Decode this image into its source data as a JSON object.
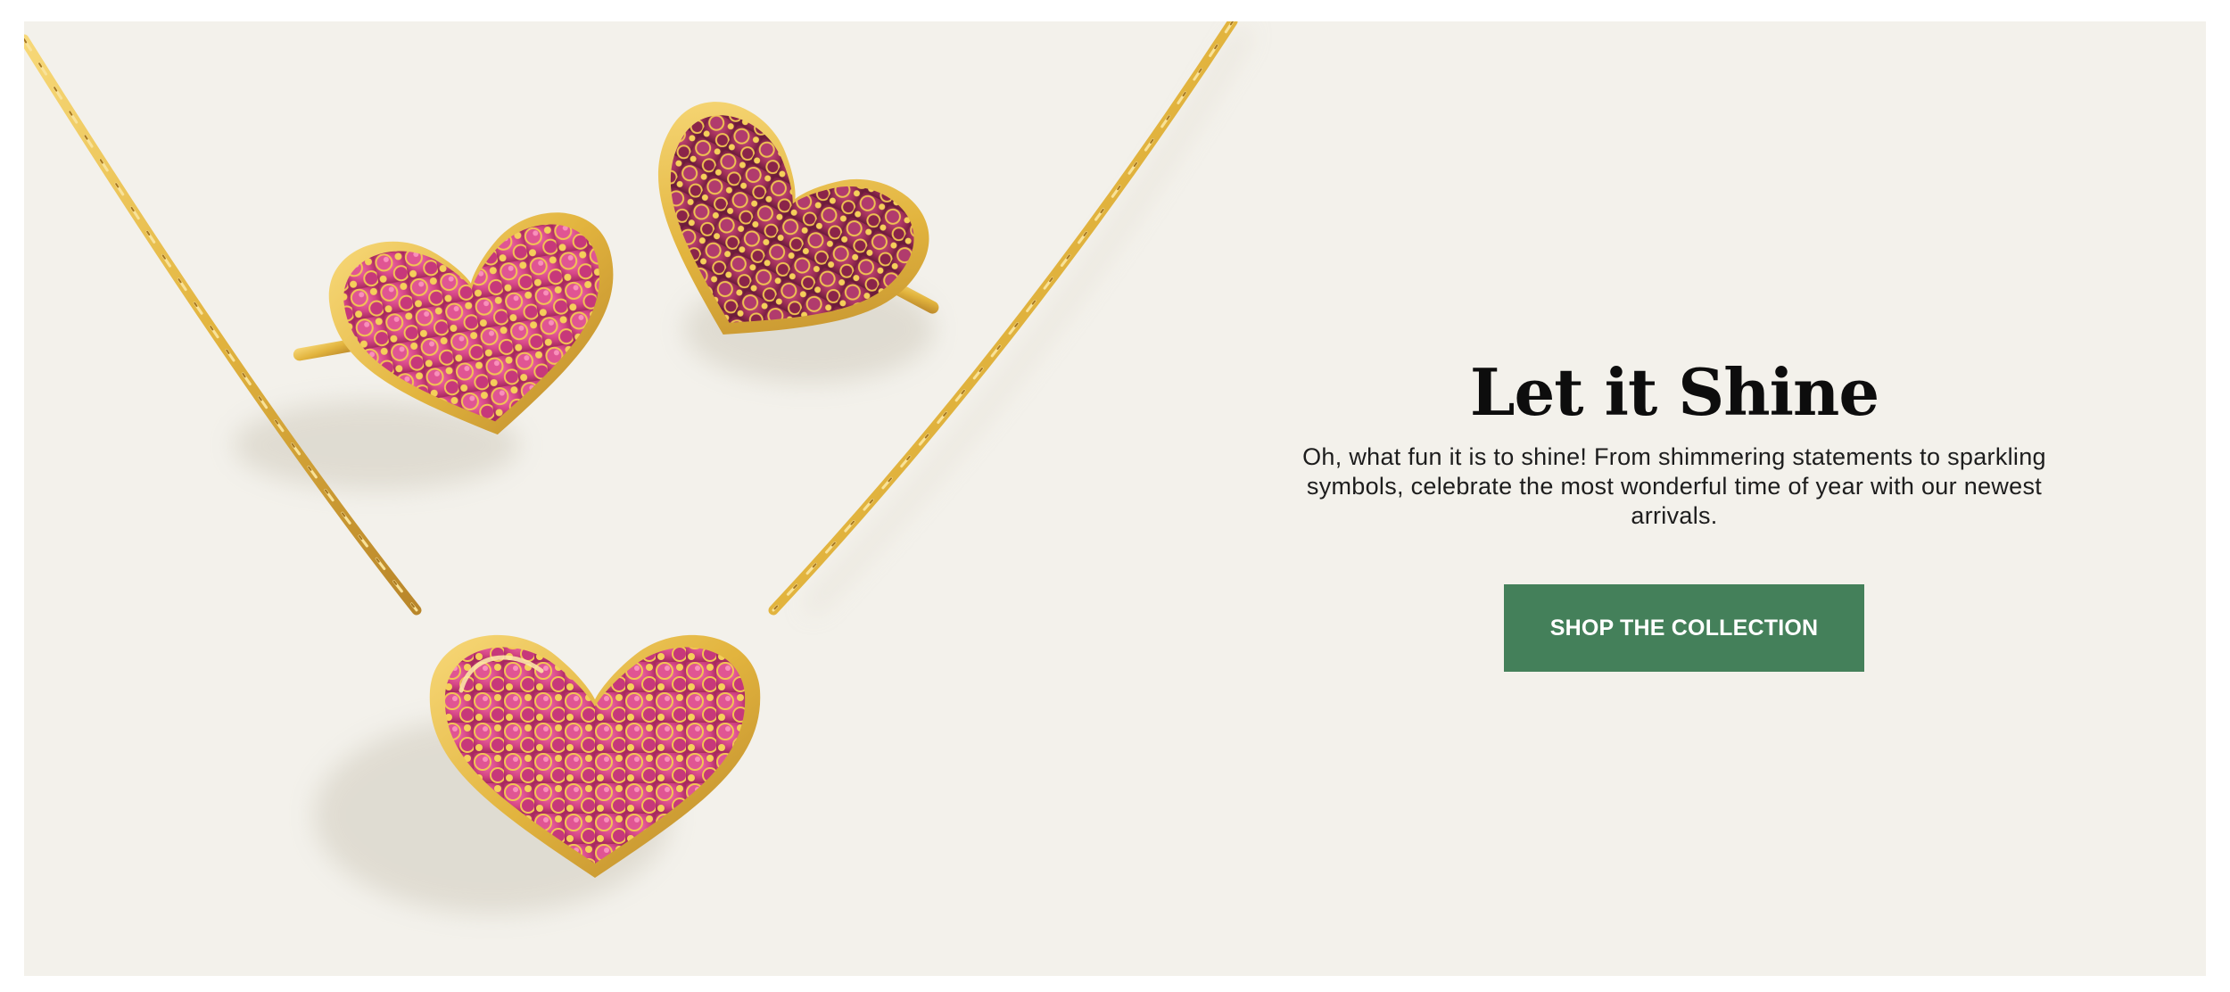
{
  "hero": {
    "headline": "Let it Shine",
    "body": "Oh, what fun it is to shine! From shimmering statements to sparkling symbols, celebrate the most wonderful time of year with our newest arrivals.",
    "cta_label": "SHOP THE COLLECTION"
  },
  "images": {
    "product": "heart-jewelry-photo"
  },
  "colors": {
    "page_background": "#ffffff",
    "hero_background": "#f3f1eb",
    "cta_background": "#44805a",
    "cta_text": "#ffffff",
    "headline_text": "#0d0d0d",
    "gold": "#e2b43e",
    "gem_pink": "#d94f8e"
  }
}
